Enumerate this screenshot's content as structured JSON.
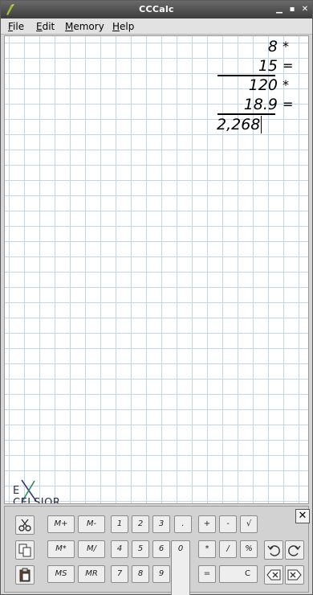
{
  "window": {
    "title": "CCCalc"
  },
  "menu": [
    "File",
    "Edit",
    "Memory",
    "Help"
  ],
  "menu_mnemonics": [
    "F",
    "E",
    "M",
    "H"
  ],
  "tape": {
    "lines": [
      {
        "value": "8",
        "op": "*"
      },
      {
        "value": "15",
        "op": "="
      },
      {
        "value": "120",
        "op": "*"
      },
      {
        "value": "18.9",
        "op": "="
      }
    ],
    "current": "2,268"
  },
  "logo": {
    "text_e": "E",
    "text_rest": "CELSIOR"
  },
  "keypad": {
    "memory": [
      "M+",
      "M-",
      "M*",
      "M/",
      "MS",
      "MR"
    ],
    "digits": [
      "1",
      "2",
      "3",
      "4",
      "5",
      "6",
      "7",
      "8",
      "9",
      "0",
      "."
    ],
    "ops": [
      "+",
      "-",
      "√",
      "*",
      "/",
      "%",
      "=",
      "C"
    ],
    "close": "✕"
  }
}
